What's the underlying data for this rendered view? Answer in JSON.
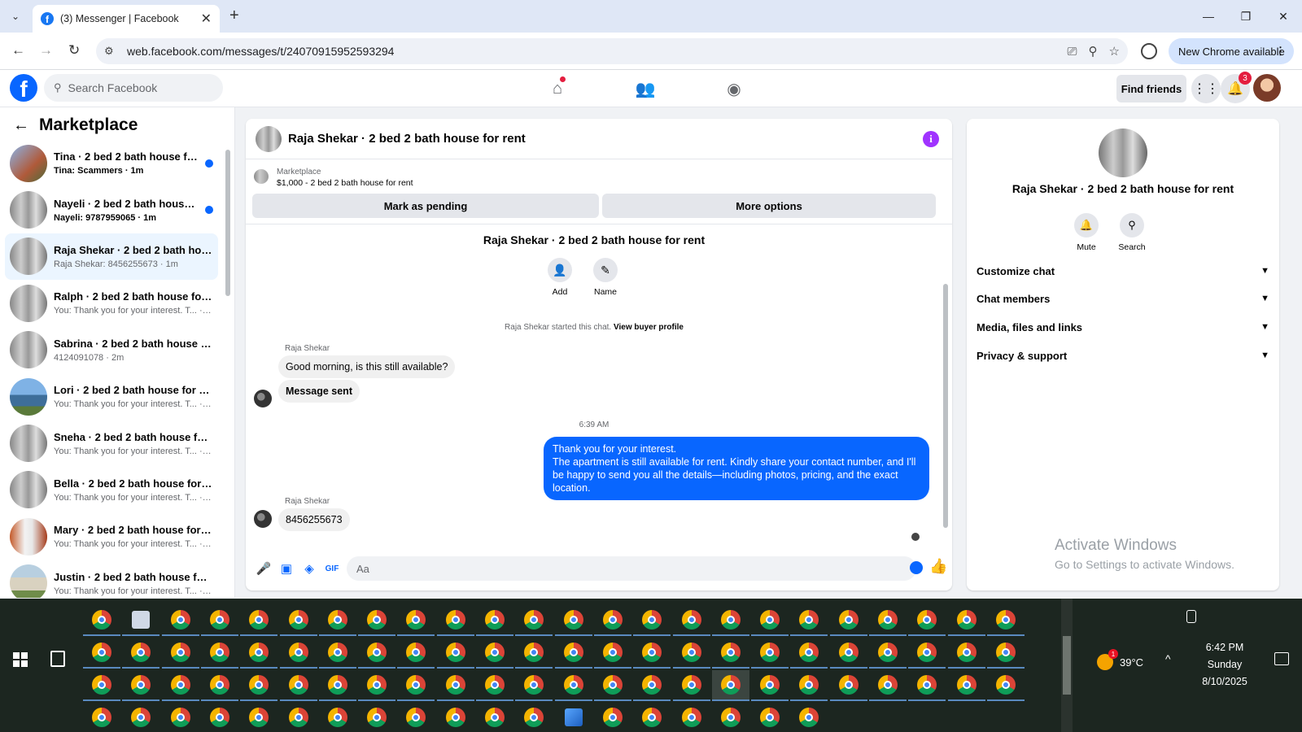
{
  "browser": {
    "tab_title": "(3) Messenger | Facebook",
    "url": "web.facebook.com/messages/t/24070915952593294",
    "new_chrome_label": "New Chrome available"
  },
  "fbnav": {
    "search_placeholder": "Search Facebook",
    "find_friends": "Find friends",
    "notification_count": "3"
  },
  "left": {
    "title": "Marketplace",
    "chats": [
      {
        "name": "Tina · 2 bed 2 bath house for r...",
        "preview": "Tina: Scammers · 1m",
        "unread": true
      },
      {
        "name": "Nayeli · 2 bed 2 bath house fo...",
        "preview": "Nayeli: 9787959065 · 1m",
        "unread": true
      },
      {
        "name": "Raja Shekar · 2 bed 2 bath hous...",
        "preview": "Raja Shekar: 8456255673 · 1m",
        "unread": false
      },
      {
        "name": "Ralph · 2 bed 2 bath house for r...",
        "preview": "You: Thank you for your interest. T... · 2m",
        "unread": false
      },
      {
        "name": "Sabrina · 2 bed 2 bath house fo...",
        "preview": "4124091078 · 2m",
        "unread": false
      },
      {
        "name": "Lori · 2 bed 2 bath house for rent",
        "preview": "You: Thank you for your interest. T... · 2m",
        "unread": false
      },
      {
        "name": "Sneha · 2 bed 2 bath house for ...",
        "preview": "You: Thank you for your interest. T... · 2m",
        "unread": false
      },
      {
        "name": "Bella · 2 bed 2 bath house for r...",
        "preview": "You: Thank you for your interest. T... · 2m",
        "unread": false
      },
      {
        "name": "Mary · 2 bed 2 bath house for r...",
        "preview": "You: Thank you for your interest. T... · 2m",
        "unread": false
      },
      {
        "name": "Justin · 2 bed 2 bath house for r...",
        "preview": "You: Thank you for your interest. T... · 2m",
        "unread": false
      }
    ]
  },
  "conversation": {
    "title": "Raja Shekar · 2 bed 2 bath house for rent",
    "marketplace_label": "Marketplace",
    "listing": "$1,000 - 2 bed 2 bath house for rent",
    "mark_pending": "Mark as pending",
    "more_options": "More options",
    "intro_name": "Raja Shekar · 2 bed 2 bath house for rent",
    "add_label": "Add",
    "name_label": "Name",
    "started_text": "Raja Shekar started this chat.",
    "view_profile": "View buyer profile",
    "sender": "Raja Shekar",
    "msg1": "Good morning, is this still available?",
    "msg2": "Message sent",
    "time": "6:39 AM",
    "out_line1": "Thank you for your interest.",
    "out_line2": "The apartment is still available for rent. Kindly share your contact number, and I'll be happy to send you all the details—including photos, pricing, and the exact location.",
    "msg3": "8456255673",
    "composer_placeholder": "Aa"
  },
  "right": {
    "name": "Raja Shekar · 2 bed 2 bath house for rent",
    "mute": "Mute",
    "search": "Search",
    "sections": [
      "Customize chat",
      "Chat members",
      "Media, files and links",
      "Privacy & support"
    ]
  },
  "watermark": {
    "line1": "Activate Windows",
    "line2": "Go to Settings to activate Windows."
  },
  "taskbar": {
    "temperature": "39°C",
    "time": "6:42 PM",
    "day": "Sunday",
    "date": "8/10/2025",
    "weather_badge": "1"
  }
}
